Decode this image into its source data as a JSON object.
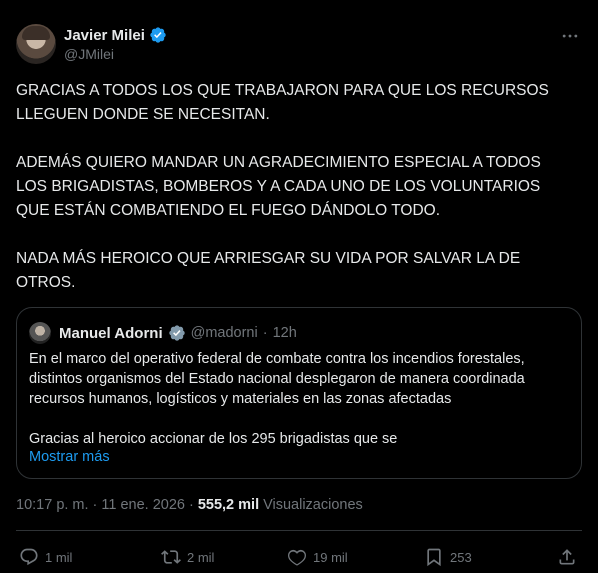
{
  "author": {
    "display_name": "Javier Milei",
    "handle": "@JMilei",
    "verified": true
  },
  "tweet_text": "GRACIAS A TODOS LOS QUE TRABAJARON PARA QUE LOS RECURSOS\nLLEGUEN DONDE SE NECESITAN.\n\nADEMÁS QUIERO MANDAR UN AGRADECIMIENTO ESPECIAL A TODOS\nLOS BRIGADISTAS, BOMBEROS Y A CADA UNO DE LOS VOLUNTARIOS\nQUE ESTÁN COMBATIENDO EL FUEGO DÁNDOLO TODO.\n\nNADA MÁS HEROICO QUE ARRIESGAR SU VIDA POR SALVAR LA DE\nOTROS.",
  "quote": {
    "display_name": "Manuel Adorni",
    "handle": "@madorni",
    "separator": "·",
    "time": "12h",
    "text": "En el marco del operativo federal de combate contra los incendios forestales,\ndistintos organismos del Estado nacional desplegaron de manera coordinada\nrecursos humanos, logísticos y materiales en las zonas afectadas\n\nGracias al heroico accionar de los 295 brigadistas que se",
    "show_more": "Mostrar más"
  },
  "meta": {
    "time": "10:17 p. m.",
    "dot1": "·",
    "date": "11 ene. 2026",
    "dot2": "·",
    "views_count": "555,2 mil",
    "views_label": "Visualizaciones"
  },
  "actions": {
    "replies": "1 mil",
    "reposts": "2 mil",
    "likes": "19 mil",
    "bookmarks": "253"
  },
  "icons": {
    "more": "more-icon",
    "verified": "verified-badge-icon",
    "reply": "reply-icon",
    "repost": "repost-icon",
    "like": "heart-icon",
    "bookmark": "bookmark-icon",
    "share": "share-icon"
  },
  "colors": {
    "background": "#000000",
    "text": "#e7e9ea",
    "muted": "#71767b",
    "link": "#1d9bf0",
    "verified": "#1d9bf0",
    "border": "#2f3336"
  }
}
